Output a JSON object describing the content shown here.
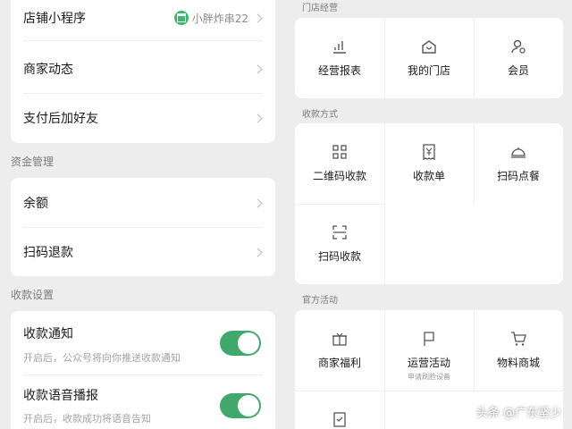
{
  "left": {
    "top_card": {
      "items": [
        {
          "label": "店铺小程序",
          "tag": "小胖炸串22"
        },
        {
          "label": "商家动态"
        },
        {
          "label": "支付后加好友"
        }
      ]
    },
    "funds": {
      "title": "资金管理",
      "items": [
        {
          "label": "余额"
        },
        {
          "label": "扫码退款"
        }
      ]
    },
    "settings": {
      "title": "收款设置",
      "items": [
        {
          "label": "收款通知",
          "desc": "开启后，公众号将向你推送收款通知",
          "enabled": true
        },
        {
          "label": "收款语音播报",
          "desc": "开启后，收款成功将语音告知",
          "enabled": true
        }
      ]
    }
  },
  "right": {
    "store": {
      "title": "门店经营",
      "items": [
        {
          "label": "经营报表",
          "icon": "bar-chart-icon"
        },
        {
          "label": "我的门店",
          "icon": "store-icon"
        },
        {
          "label": "会员",
          "icon": "member-icon"
        }
      ]
    },
    "payment": {
      "title": "收款方式",
      "items": [
        {
          "label": "二维码收款",
          "icon": "qr-code-icon"
        },
        {
          "label": "收款单",
          "icon": "receipt-icon"
        },
        {
          "label": "扫码点餐",
          "icon": "dining-icon"
        },
        {
          "label": "扫码收款",
          "icon": "scan-icon"
        }
      ]
    },
    "events": {
      "title": "官方活动",
      "items": [
        {
          "label": "商家福利",
          "icon": "gift-icon"
        },
        {
          "label": "运营活动",
          "sub": "申请刷脸设备",
          "icon": "flag-icon"
        },
        {
          "label": "物料商城",
          "icon": "cart-icon"
        },
        {
          "label": "",
          "icon": "checklist-icon"
        }
      ]
    }
  },
  "watermark": "头条 @广东坚少",
  "colors": {
    "accent": "#3fa86a",
    "background": "#ededed"
  }
}
